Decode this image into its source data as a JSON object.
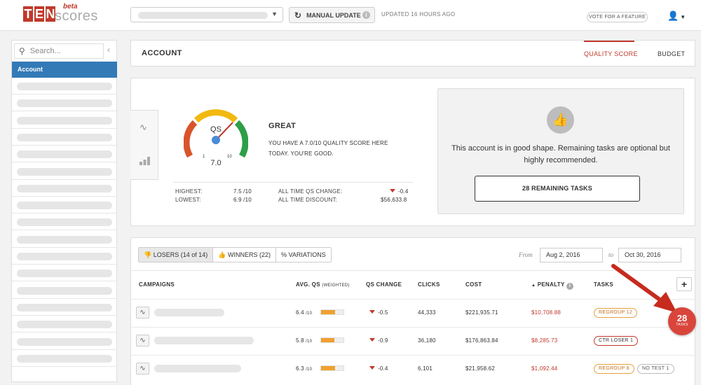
{
  "logo": {
    "letters": [
      "T",
      "E",
      "N"
    ],
    "scores": "scores",
    "beta": "beta"
  },
  "header": {
    "manual_update": "MANUAL UPDATE",
    "updated": "UPDATED 16 HOURS AGO",
    "vote": "VOTE FOR A FEATURE",
    "user_icon": "user-icon"
  },
  "sidebar": {
    "search_placeholder": "Search...",
    "selected": "Account",
    "placeholder_rows": 17
  },
  "account": {
    "title": "ACCOUNT",
    "tabs": [
      "QUALITY SCORE",
      "BUDGET"
    ]
  },
  "quality": {
    "gauge_label": "QS",
    "gauge_value": "7.0",
    "gauge_min": "1",
    "gauge_max": "10",
    "headline": "GREAT",
    "desc": "YOU HAVE A 7.0/10 QUALITY SCORE HERE TODAY. YOU'RE GOOD.",
    "highest_label": "HIGHEST:",
    "highest_value": "7.5 /10",
    "lowest_label": "LOWEST:",
    "lowest_value": "6.9 /10",
    "qs_change_label": "ALL TIME QS CHANGE:",
    "qs_change_value": "-0.4",
    "discount_label": "ALL TIME DISCOUNT:",
    "discount_value": "$56,633.8"
  },
  "shape": {
    "text": "This account is in good shape. Remaining tasks are optional but highly recommended.",
    "button": "28 REMAINING TASKS"
  },
  "filters": {
    "losers": "LOSERS (14 of 14)",
    "winners": "WINNERS (22)",
    "variations": "% VARIATIONS",
    "from_label": "From",
    "from_date": "Aug 2, 2016",
    "to_label": "to",
    "to_date": "Oct 30, 2016"
  },
  "table": {
    "headers": {
      "campaigns": "CAMPAIGNS",
      "avg_qs": "AVG. QS",
      "weighted": "(WEIGHTED)",
      "qs_change": "QS CHANGE",
      "clicks": "CLICKS",
      "cost": "COST",
      "penalty": "PENALTY",
      "tasks": "TASKS"
    },
    "rows": [
      {
        "qs": "6.4",
        "of": "/10",
        "fill": 0.64,
        "change": "-0.5",
        "clicks": "44,333",
        "cost": "$221,935.71",
        "penalty": "$10,708.88",
        "tags": [
          "REGROUP 12"
        ]
      },
      {
        "qs": "5.8",
        "of": "/10",
        "fill": 0.58,
        "change": "-0.9",
        "clicks": "36,180",
        "cost": "$176,863.84",
        "penalty": "$8,285.73",
        "tags": [
          "CTR LOSER 1"
        ]
      },
      {
        "qs": "6.3",
        "of": "/10",
        "fill": 0.63,
        "change": "-0.4",
        "clicks": "6,101",
        "cost": "$21,958.62",
        "penalty": "$1,092.44",
        "tags": [
          "REGROUP 8",
          "NO TEST 1"
        ]
      }
    ]
  },
  "badge": {
    "count": "28",
    "label": "TASKS"
  },
  "colors": {
    "brand_red": "#c0392b",
    "selected_blue": "#337ab7",
    "bar_orange": "#f0a030",
    "green": "#2e8b3b"
  }
}
